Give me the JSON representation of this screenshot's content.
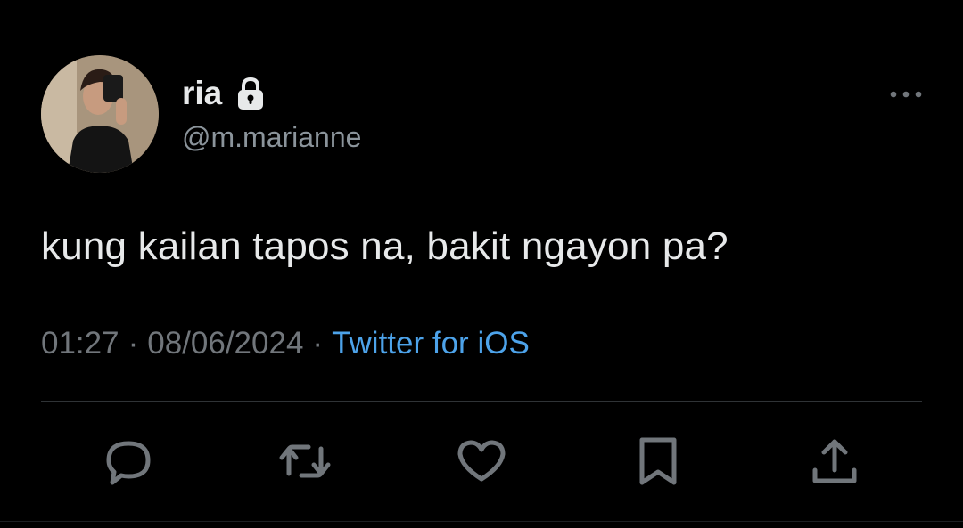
{
  "tweet": {
    "display_name": "ria",
    "handle": "@m.marianne",
    "text": "kung kailan tapos na, bakit ngayon pa?",
    "time": "01:27",
    "date": "08/06/2024",
    "separator": "·",
    "source": "Twitter for iOS",
    "protected": true
  },
  "icons": {
    "lock": "lock-icon",
    "more": "more-icon",
    "reply": "reply-icon",
    "retweet": "retweet-icon",
    "like": "heart-icon",
    "bookmark": "bookmark-icon",
    "share": "share-icon"
  },
  "colors": {
    "background": "#000000",
    "text": "#e7e9ea",
    "muted": "#71767b",
    "link": "#4da3ea",
    "divider": "#2f3336"
  }
}
